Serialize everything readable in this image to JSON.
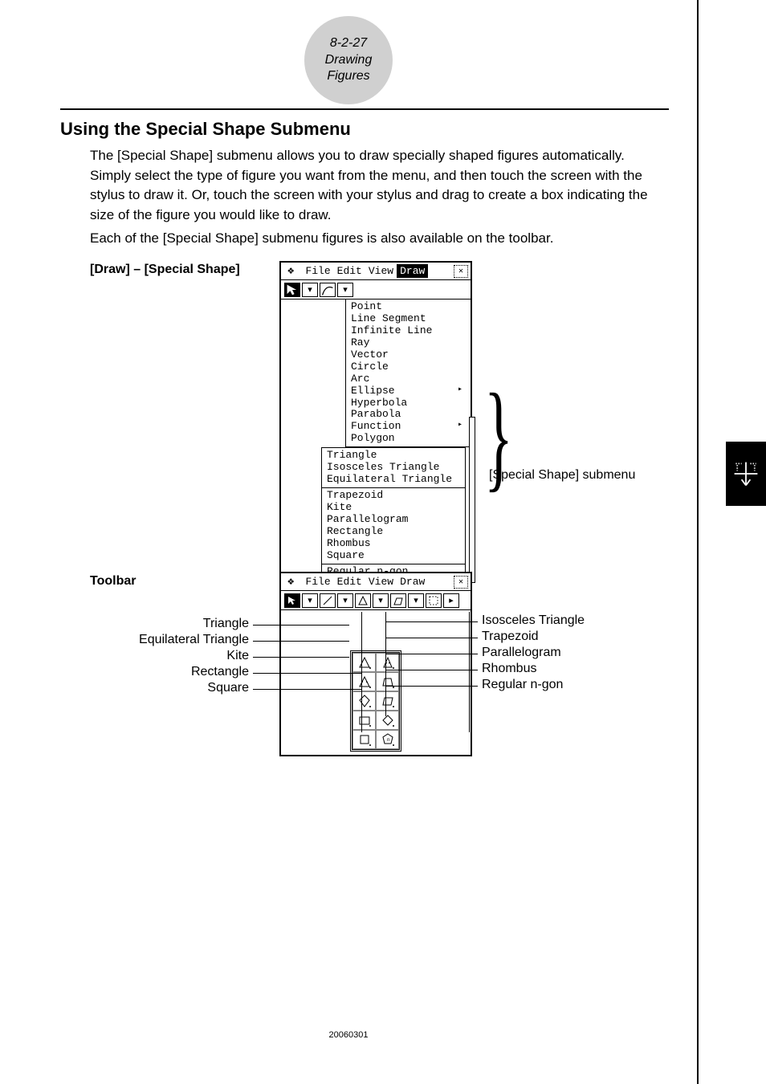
{
  "header": {
    "pageno": "8-2-27",
    "section": "Drawing Figures"
  },
  "title": "Using the Special Shape Submenu",
  "para1": "The [Special Shape] submenu allows you to draw specially shaped figures automatically. Simply select the type of figure you want from the menu, and then touch the screen with the stylus to draw it. Or, touch the screen with your stylus and drag to create a box indicating the size of the figure you would like to draw.",
  "para2": "Each of the [Special Shape] submenu figures is also available on the toolbar.",
  "labels": {
    "drawSpecial": "[Draw] – [Special Shape]",
    "toolbar": "Toolbar",
    "submenu": "[Special Shape] submenu"
  },
  "menubar": {
    "file": "File",
    "edit": "Edit",
    "view": "View",
    "draw": "Draw"
  },
  "drawMenu": {
    "group1": [
      "Point",
      "Line Segment",
      "Infinite Line",
      "Ray",
      "Vector",
      "Circle",
      "Arc",
      "Ellipse",
      "Hyperbola",
      "Parabola",
      "Function",
      "Polygon"
    ],
    "arrows": [
      "Ellipse",
      "Function"
    ],
    "group2": [
      "Triangle",
      "Isosceles Triangle",
      "Equilateral Triangle"
    ],
    "group3": [
      "Trapezoid",
      "Kite",
      "Parallelogram",
      "Rectangle",
      "Rhombus",
      "Square"
    ],
    "group4": [
      "Regular n-gon"
    ]
  },
  "leftCallouts": [
    "Triangle",
    "Equilateral Triangle",
    "Kite",
    "Rectangle",
    "Square"
  ],
  "rightCallouts": [
    "Isosceles Triangle",
    "Trapezoid",
    "Parallelogram",
    "Rhombus",
    "Regular n-gon"
  ],
  "footer": "20060301"
}
